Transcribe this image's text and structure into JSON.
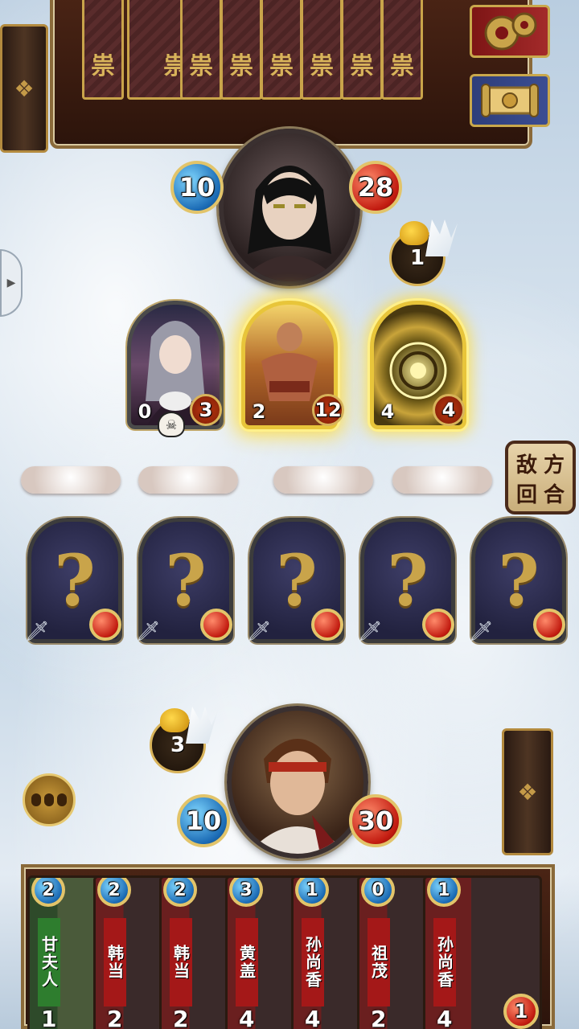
{
  "enemy_hand": {
    "card_glyph": "祟",
    "count": 7
  },
  "enemy_hero": {
    "mana": "10",
    "health": "28",
    "weapon_charges": "1"
  },
  "enemy_board": [
    {
      "attack": "0",
      "health": "3",
      "has_skull": true
    },
    {
      "attack": "2",
      "health": "12",
      "has_skull": false
    },
    {
      "attack": "4",
      "health": "4",
      "has_skull": false
    }
  ],
  "hidden_cards": [
    "?",
    "?",
    "?",
    "?",
    "?"
  ],
  "turn_button": {
    "chars": [
      "敌",
      "方",
      "回",
      "合"
    ]
  },
  "player_hero": {
    "mana": "10",
    "health": "30",
    "weapon_charges": "3"
  },
  "player_hand": [
    {
      "cost": "2",
      "name": "甘夫人",
      "attack": "1",
      "color": "green"
    },
    {
      "cost": "2",
      "name": "韩当",
      "attack": "2",
      "color": "red"
    },
    {
      "cost": "2",
      "name": "韩当",
      "attack": "2",
      "color": "red"
    },
    {
      "cost": "3",
      "name": "黄盖",
      "attack": "4",
      "color": "red"
    },
    {
      "cost": "1",
      "name": "孙尚香",
      "attack": "4",
      "color": "red"
    },
    {
      "cost": "0",
      "name": "祖茂",
      "attack": "2",
      "color": "red"
    },
    {
      "cost": "1",
      "name": "孙尚香",
      "attack": "4",
      "color": "red"
    }
  ],
  "last_card_health": "1",
  "colors": {
    "mana": "#1b6bb5",
    "health": "#c21b10",
    "gold": "#c9a44a"
  },
  "icons": {
    "settings": "gear-icon",
    "log": "scroll-icon",
    "emote": "emote-icon"
  }
}
